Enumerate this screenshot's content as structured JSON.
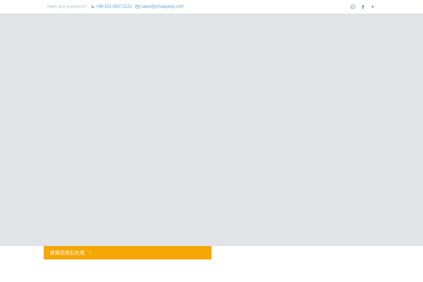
{
  "topbar": {
    "question": "Have any questions?",
    "phone": "+86-531-88272222",
    "email": "sales@jchuayang.com",
    "social": [
      "whatsapp-icon",
      "facebook-icon",
      "youtube-icon"
    ]
  },
  "menu": {
    "label": "蜂窝花岗石应用",
    "chevron": "›"
  },
  "colors": {
    "accent": "#f5a703",
    "link": "#5aa6d6",
    "hero_bg": "#e1e4e7",
    "muted_text": "#b8bcc0"
  }
}
